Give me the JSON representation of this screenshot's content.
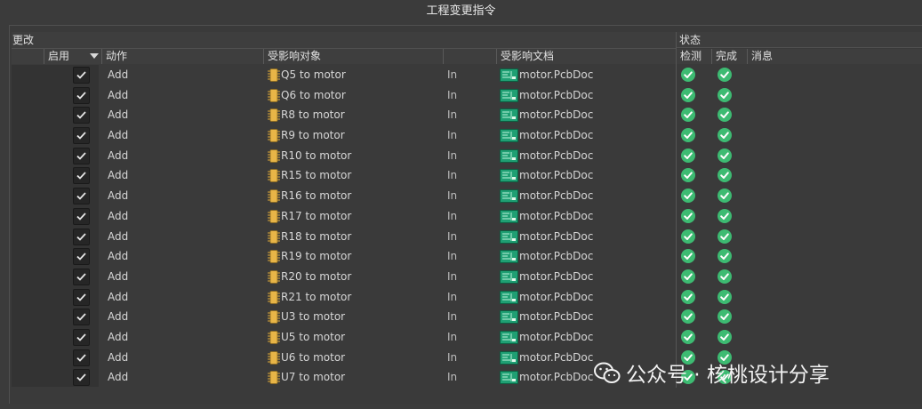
{
  "window": {
    "title": "工程变更指令"
  },
  "groups": {
    "changes": "更改",
    "status": "状态"
  },
  "columns": {
    "enable": "启用",
    "action": "动作",
    "affected_object": "受影响对象",
    "affected_document": "受影响文档",
    "check": "检测",
    "done": "完成",
    "message": "消息"
  },
  "rows": [
    {
      "action": "Add",
      "object": "Q5 to motor",
      "in": "In",
      "document": "motor.PcbDoc"
    },
    {
      "action": "Add",
      "object": "Q6 to motor",
      "in": "In",
      "document": "motor.PcbDoc"
    },
    {
      "action": "Add",
      "object": "R8 to motor",
      "in": "In",
      "document": "motor.PcbDoc"
    },
    {
      "action": "Add",
      "object": "R9 to motor",
      "in": "In",
      "document": "motor.PcbDoc"
    },
    {
      "action": "Add",
      "object": "R10 to motor",
      "in": "In",
      "document": "motor.PcbDoc"
    },
    {
      "action": "Add",
      "object": "R15 to motor",
      "in": "In",
      "document": "motor.PcbDoc"
    },
    {
      "action": "Add",
      "object": "R16 to motor",
      "in": "In",
      "document": "motor.PcbDoc"
    },
    {
      "action": "Add",
      "object": "R17 to motor",
      "in": "In",
      "document": "motor.PcbDoc"
    },
    {
      "action": "Add",
      "object": "R18 to motor",
      "in": "In",
      "document": "motor.PcbDoc"
    },
    {
      "action": "Add",
      "object": "R19 to motor",
      "in": "In",
      "document": "motor.PcbDoc"
    },
    {
      "action": "Add",
      "object": "R20 to motor",
      "in": "In",
      "document": "motor.PcbDoc"
    },
    {
      "action": "Add",
      "object": "R21 to motor",
      "in": "In",
      "document": "motor.PcbDoc"
    },
    {
      "action": "Add",
      "object": "U3 to motor",
      "in": "In",
      "document": "motor.PcbDoc"
    },
    {
      "action": "Add",
      "object": "U5 to motor",
      "in": "In",
      "document": "motor.PcbDoc"
    },
    {
      "action": "Add",
      "object": "U6 to motor",
      "in": "In",
      "document": "motor.PcbDoc"
    },
    {
      "action": "Add",
      "object": "U7 to motor",
      "in": "In",
      "document": "motor.PcbDoc"
    }
  ],
  "watermark": {
    "text": "公众号 · 核桃设计分享"
  },
  "colors": {
    "ok": "#3dbb72",
    "component": "#e8b547",
    "pcb": "#1f9f73"
  }
}
